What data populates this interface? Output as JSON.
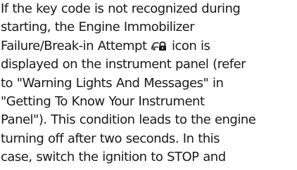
{
  "document": {
    "paragraph": {
      "line1": "If the key code is not recognized during",
      "line2": "starting, the Engine Immobilizer",
      "line3_before_icon": "Failure/Break-in Attempt",
      "line3_after_icon": "icon is",
      "line4": "displayed on the instrument panel (refer",
      "line5": "to \"Warning Lights And Messages\" in",
      "line6": "\"Getting To Know Your Instrument",
      "line7": "Panel\"). This condition leads to the engine",
      "line8": "turning off after two seconds. In this",
      "line9": "case, switch the ignition to STOP and"
    },
    "icon_name": "car-lock-icon",
    "text_color": "#1a1a1a",
    "background_color": "#ffffff"
  }
}
